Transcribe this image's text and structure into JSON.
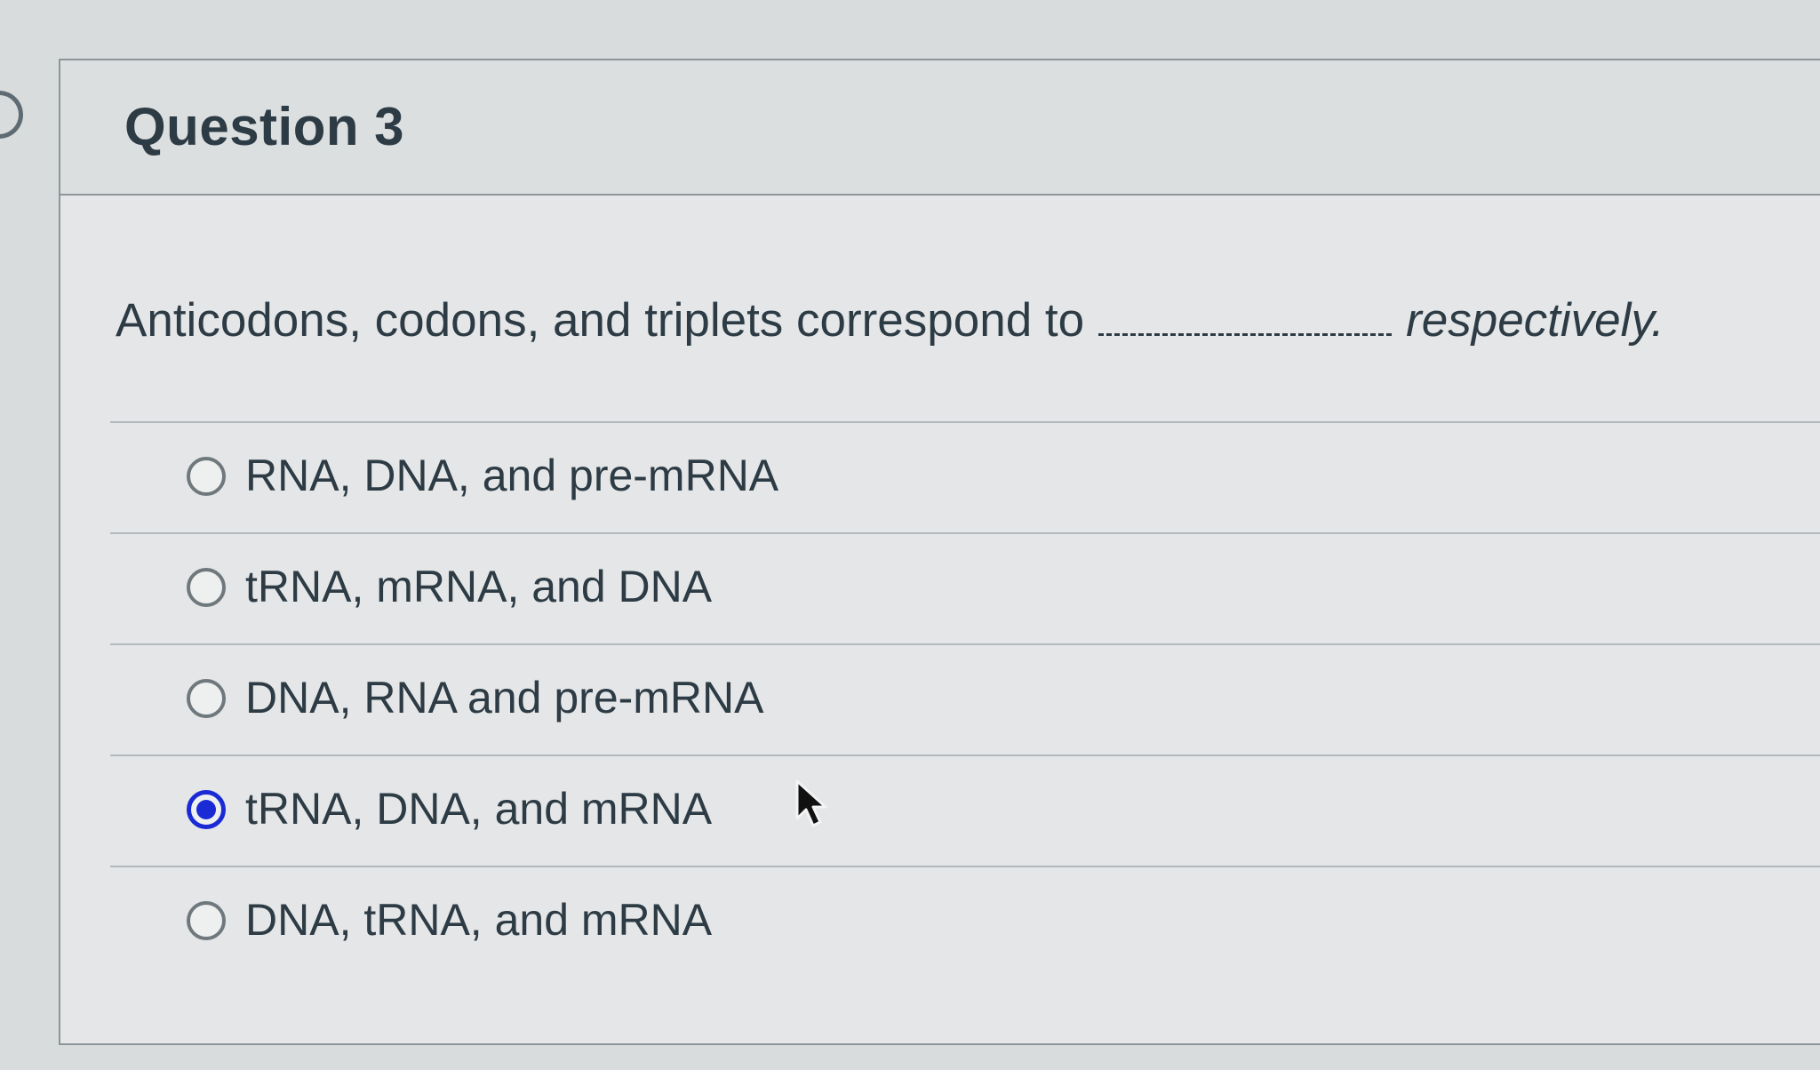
{
  "question": {
    "title": "Question 3",
    "text_before": "Anticodons, codons, and triplets correspond to",
    "text_after": "respectively."
  },
  "answers": [
    {
      "label": "RNA, DNA, and pre-mRNA",
      "selected": false
    },
    {
      "label": "tRNA, mRNA, and DNA",
      "selected": false
    },
    {
      "label": "DNA, RNA and pre-mRNA",
      "selected": false
    },
    {
      "label": "tRNA, DNA, and mRNA",
      "selected": true
    },
    {
      "label": "DNA, tRNA, and mRNA",
      "selected": false
    }
  ],
  "colors": {
    "accent": "#1a2bd6",
    "text": "#2d3b45",
    "border": "#8d9599"
  }
}
